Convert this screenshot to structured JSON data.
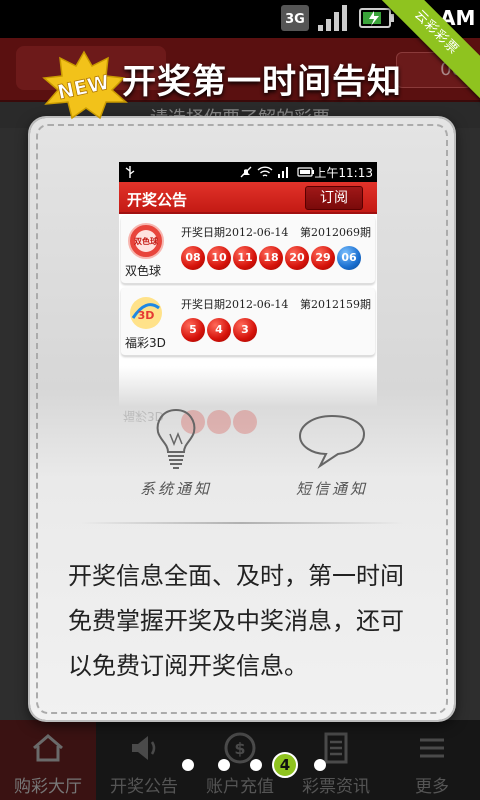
{
  "status_bar": {
    "network": "3G",
    "clock": "AM"
  },
  "ribbon": {
    "text": "云彩彩票"
  },
  "background": {
    "header_right": "00"
  },
  "overlay": {
    "badge": "NEW",
    "headline": "开奖第一时间告知",
    "sub_text": "请选择你要了解的彩票"
  },
  "mock": {
    "status_time": "上午11:13",
    "title": "开奖公告",
    "subscribe_label": "订阅",
    "rows": [
      {
        "name": "双色球",
        "logo_text": "双色球",
        "date": "开奖日期2012-06-14",
        "issue": "第2012069期",
        "red_balls": [
          "08",
          "10",
          "11",
          "18",
          "20",
          "29"
        ],
        "blue_balls": [
          "06"
        ]
      },
      {
        "name": "福彩3D",
        "logo_text": "3D",
        "date": "开奖日期2012-06-14",
        "issue": "第2012159期",
        "red_balls": [
          "5",
          "4",
          "3"
        ],
        "blue_balls": []
      }
    ],
    "reflection_name": "福彩3D"
  },
  "notifications": [
    {
      "label": "系统通知",
      "icon": "lightbulb-icon"
    },
    {
      "label": "短信通知",
      "icon": "speech-bubble-icon"
    }
  ],
  "description": "开奖信息全面、及时，第一时间免费掌握开奖及中奖消息，还可以免费订阅开奖信息。",
  "pager": {
    "current": "4",
    "total_dots": 5
  },
  "bottom_nav": [
    {
      "label": "购彩大厅",
      "icon": "home-icon"
    },
    {
      "label": "开奖公告",
      "icon": "speaker-icon"
    },
    {
      "label": "账户充值",
      "icon": "coin-icon"
    },
    {
      "label": "彩票资讯",
      "icon": "document-icon"
    },
    {
      "label": "更多",
      "icon": "more-icon"
    }
  ],
  "colors": {
    "accent_green": "#8fc31f",
    "header_red": "#d5221a",
    "ball_red": "#d5120a",
    "ball_blue": "#1a6fd0"
  }
}
